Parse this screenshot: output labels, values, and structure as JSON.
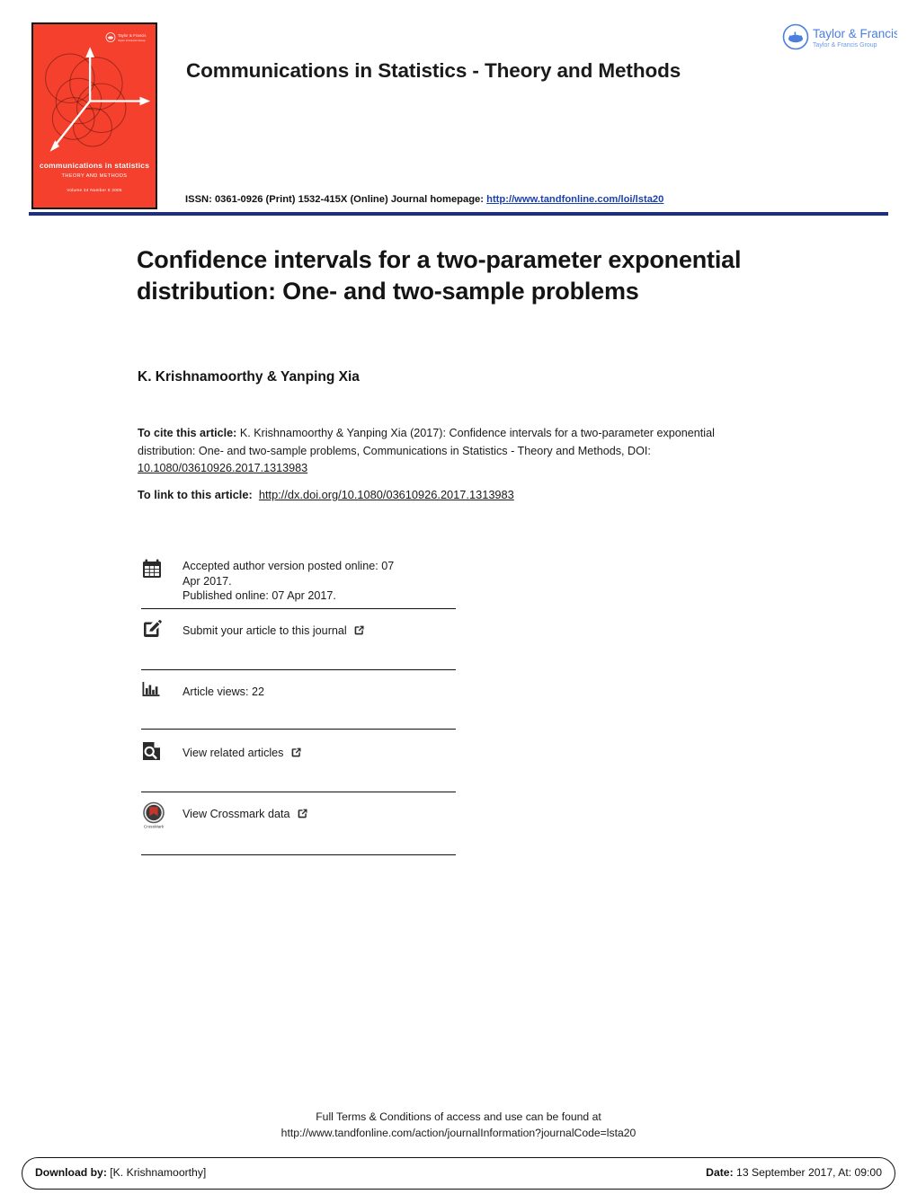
{
  "header": {
    "journal_title": "Communications in Statistics - Theory and Methods",
    "issn_prefix": "ISSN: 0361-0926 (Print) 1532-415X (Online) Journal homepage:",
    "issn_link": "http://www.tandfonline.com/loi/lsta20",
    "publisher_logo": {
      "name": "Taylor & Francis",
      "tagline": "Taylor & Francis Group",
      "icon": "taylor-francis-emblem-icon",
      "color": "#4a7fe0"
    },
    "cover": {
      "title": "communications in statistics",
      "subtitle": "THEORY AND METHODS",
      "volume_line": "Volume 34    Number 8     2005",
      "background_color": "#f4402c",
      "icon": "journal-cover-image"
    },
    "rule_color": "#1f2f7a"
  },
  "article": {
    "title": "Confidence intervals for a two-parameter exponential distribution: One- and two-sample problems",
    "authors": "K. Krishnamoorthy & Yanping Xia",
    "cite_label": "To cite this article:",
    "cite_text": " K. Krishnamoorthy & Yanping Xia (2017): Confidence intervals for a two-parameter exponential distribution: One- and two-sample problems, Communications in Statistics - Theory and Methods, DOI: ",
    "cite_doi": "10.1080/03610926.2017.1313983",
    "link_label": "To link to this article:",
    "link_url": "http://dx.doi.org/10.1080/03610926.2017.1313983"
  },
  "meta_rows": [
    {
      "icon": "calendar-icon",
      "line1": "Accepted author version posted online: 07",
      "line2": "Apr 2017.",
      "line3": "Published online: 07 Apr 2017.",
      "external": false
    },
    {
      "icon": "pencil-square-icon",
      "line1": "Submit your article to this journal",
      "external": true
    },
    {
      "icon": "bar-chart-icon",
      "line1": "Article views: 22",
      "external": false
    },
    {
      "icon": "document-search-icon",
      "line1": "View related articles",
      "external": true
    },
    {
      "icon": "crossmark-icon",
      "line1": "View Crossmark data",
      "external": true
    }
  ],
  "footer": {
    "terms_line1": "Full Terms & Conditions of access and use can be found at",
    "terms_line2": "http://www.tandfonline.com/action/journalInformation?journalCode=lsta20",
    "download_label": "Download by:",
    "download_value": "[K. Krishnamoorthy]",
    "date_label": "Date:",
    "date_value": "13 September 2017, At: 09:00"
  }
}
